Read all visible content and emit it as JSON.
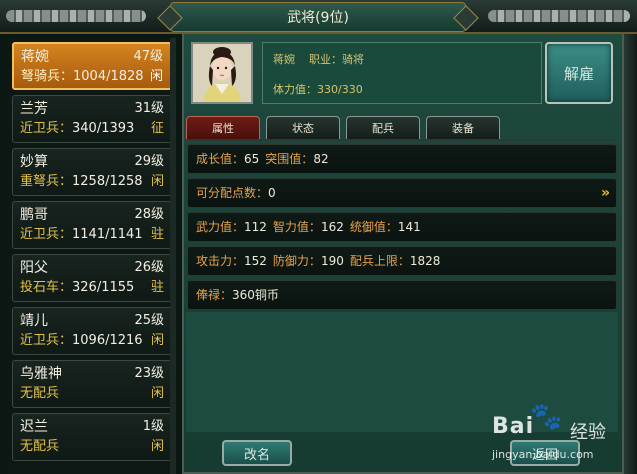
{
  "window": {
    "title": "武将(9位)"
  },
  "generals": [
    {
      "name": "蒋婉",
      "level": "47级",
      "troop": "弩骑兵：",
      "count": "1004/1828",
      "status": "闲",
      "selected": true
    },
    {
      "name": "兰芳",
      "level": "31级",
      "troop": "近卫兵：",
      "count": "340/1393",
      "status": "征"
    },
    {
      "name": "妙算",
      "level": "29级",
      "troop": "重弩兵：",
      "count": "1258/1258",
      "status": "闲"
    },
    {
      "name": "鹏哥",
      "level": "28级",
      "troop": "近卫兵：",
      "count": "1141/1141",
      "status": "驻"
    },
    {
      "name": "阳父",
      "level": "26级",
      "troop": "投石车：",
      "count": "326/1155",
      "status": "驻"
    },
    {
      "name": "靖儿",
      "level": "25级",
      "troop": "近卫兵：",
      "count": "1096/1216",
      "status": "闲"
    },
    {
      "name": "乌雅神",
      "level": "23级",
      "troop": "无配兵",
      "count": "",
      "status": "闲"
    },
    {
      "name": "迟兰",
      "level": "1级",
      "troop": "无配兵",
      "count": "",
      "status": "闲"
    }
  ],
  "detail": {
    "name": "蒋婉",
    "job_label": "职业：骑将",
    "stamina": "体力值：330/330",
    "dismiss_label": "解雇"
  },
  "tabs": [
    "属性",
    "状态",
    "配兵",
    "装备"
  ],
  "stats": {
    "growth_k": "成长值：",
    "growth_v": "65",
    "breakout_k": "突围值：",
    "breakout_v": "82",
    "points_k": "可分配点数：",
    "points_v": "0",
    "points_arrow": "»",
    "force_k": "武力值：",
    "force_v": "112",
    "intel_k": "智力值：",
    "intel_v": "162",
    "command_k": "统御值：",
    "command_v": "141",
    "attack_k": "攻击力：",
    "attack_v": "152",
    "defense_k": "防御力：",
    "defense_v": "190",
    "troopcap_k": "配兵上限：",
    "troopcap_v": "1828",
    "salary_k": "俸禄：",
    "salary_v": "360铜币"
  },
  "buttons": {
    "rename": "改名",
    "back": "返回"
  },
  "watermark": {
    "main": "Bai",
    "paw": "🐾",
    "cn": "经验",
    "url": "jingyan.baidu.com"
  }
}
